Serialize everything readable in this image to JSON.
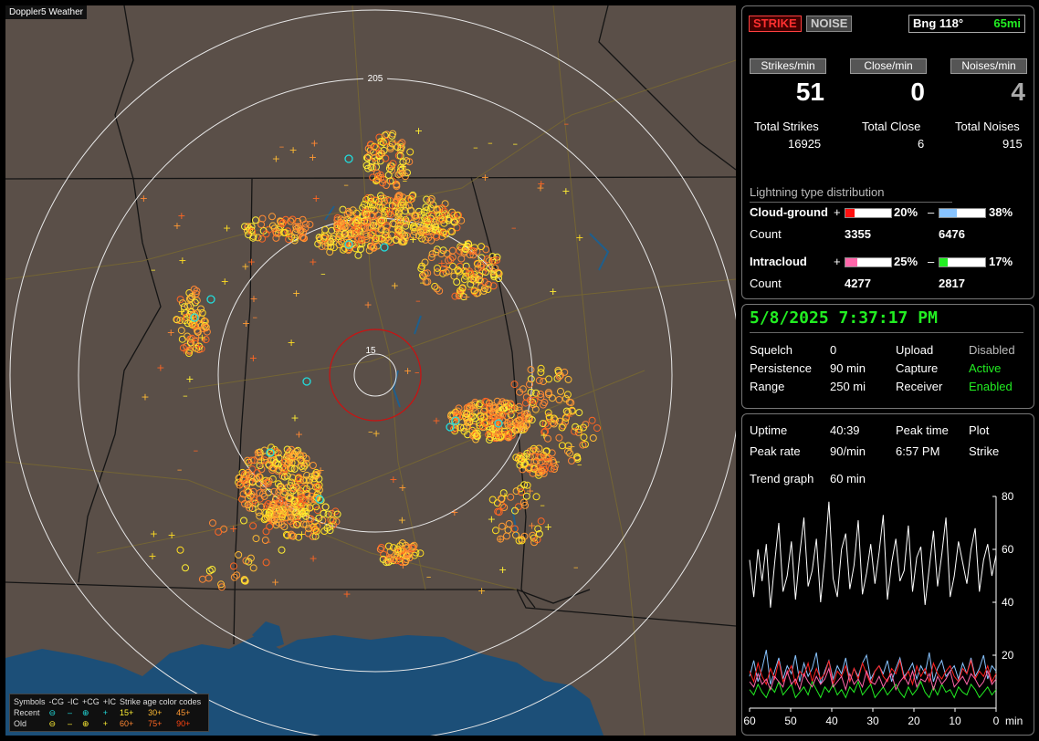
{
  "app": {
    "title": "Doppler5 Weather"
  },
  "map": {
    "range_labels": [
      "205",
      "15"
    ],
    "legend": {
      "header": [
        "Symbols",
        "-CG",
        "-IC",
        "+CG",
        "+IC"
      ],
      "age_header": "Strike age color codes",
      "rows": [
        {
          "label": "Recent",
          "ages": [
            "15+",
            "30+",
            "45+"
          ]
        },
        {
          "label": "Old",
          "ages": [
            "60+",
            "75+",
            "90+"
          ]
        }
      ]
    }
  },
  "header": {
    "strike_button": "STRIKE",
    "noise_button": "NOISE",
    "bearing_label": "Bng 118°",
    "bearing_distance": "65mi"
  },
  "rates": {
    "strikes_label": "Strikes/min",
    "strikes_value": "51",
    "close_label": "Close/min",
    "close_value": "0",
    "noises_label": "Noises/min",
    "noises_value": "4"
  },
  "totals": {
    "strikes_label": "Total Strikes",
    "strikes_value": "16925",
    "close_label": "Total Close",
    "close_value": "6",
    "noises_label": "Total Noises",
    "noises_value": "915"
  },
  "distribution": {
    "title": "Lightning type distribution",
    "cloud_ground": {
      "label": "Cloud-ground",
      "plus_pct": "20%",
      "minus_pct": "38%",
      "plus_fraction": 0.2,
      "minus_fraction": 0.38,
      "count_label": "Count",
      "plus_count": "3355",
      "minus_count": "6476",
      "plus_color": "#ff1010",
      "minus_color": "#88c4ff"
    },
    "intracloud": {
      "label": "Intracloud",
      "plus_pct": "25%",
      "minus_pct": "17%",
      "plus_fraction": 0.25,
      "minus_fraction": 0.17,
      "count_label": "Count",
      "plus_count": "4277",
      "minus_count": "2817",
      "plus_color": "#ff66aa",
      "minus_color": "#22ee22"
    },
    "plus_sign": "+",
    "minus_sign": "–"
  },
  "status": {
    "datetime": "5/8/2025 7:37:17 PM",
    "squelch_label": "Squelch",
    "squelch_value": "0",
    "persistence_label": "Persistence",
    "persistence_value": "90 min",
    "range_label": "Range",
    "range_value": "250 mi",
    "upload_label": "Upload",
    "upload_value": "Disabled",
    "capture_label": "Capture",
    "capture_value": "Active",
    "receiver_label": "Receiver",
    "receiver_value": "Enabled"
  },
  "stats": {
    "uptime_label": "Uptime",
    "uptime_value": "40:39",
    "peak_time_label": "Peak time",
    "peak_time_value": "6:57 PM",
    "plot_label": "Plot",
    "plot_value": "Strike",
    "peak_rate_label": "Peak rate",
    "peak_rate_value": "90/min",
    "trend_label": "Trend graph",
    "trend_value": "60 min"
  },
  "chart_data": {
    "type": "line",
    "xlabel": "min",
    "x_ticks": [
      "60",
      "50",
      "40",
      "30",
      "20",
      "10",
      "0"
    ],
    "y_ticks": [
      "80",
      "60",
      "40",
      "20"
    ],
    "xlim": [
      60,
      0
    ],
    "ylim": [
      0,
      80
    ],
    "series": [
      {
        "color": "#ffffff",
        "values": [
          56,
          42,
          60,
          48,
          62,
          38,
          55,
          70,
          44,
          50,
          63,
          41,
          58,
          72,
          46,
          52,
          64,
          40,
          57,
          78,
          49,
          42,
          60,
          66,
          45,
          54,
          71,
          43,
          51,
          62,
          47,
          59,
          73,
          41,
          55,
          64,
          48,
          52,
          69,
          44,
          57,
          61,
          39,
          53,
          67,
          46,
          58,
          72,
          42,
          50,
          63,
          55,
          47,
          60,
          68,
          44,
          56,
          62,
          50,
          58
        ]
      },
      {
        "color": "#88c4ff",
        "values": [
          12,
          18,
          10,
          15,
          22,
          9,
          14,
          19,
          11,
          16,
          13,
          20,
          10,
          17,
          12,
          15,
          21,
          9,
          14,
          18,
          11,
          16,
          13,
          19,
          10,
          15,
          12,
          17,
          20,
          11,
          14,
          16,
          13,
          18,
          10,
          15,
          19,
          12,
          14,
          17,
          11,
          16,
          13,
          21,
          10,
          15,
          18,
          12,
          14,
          16,
          11,
          17,
          13,
          19,
          12,
          15,
          20,
          11,
          16,
          14
        ]
      },
      {
        "color": "#ff2020",
        "values": [
          14,
          10,
          17,
          12,
          9,
          15,
          11,
          18,
          10,
          13,
          16,
          9,
          14,
          12,
          17,
          10,
          15,
          11,
          13,
          18,
          9,
          14,
          12,
          16,
          10,
          15,
          11,
          17,
          13,
          9,
          14,
          16,
          12,
          10,
          15,
          13,
          18,
          11,
          14,
          9,
          16,
          12,
          15,
          10,
          17,
          13,
          11,
          14,
          16,
          12,
          10,
          15,
          13,
          18,
          11,
          14,
          12,
          16,
          10,
          13
        ]
      },
      {
        "color": "#22ee22",
        "values": [
          7,
          5,
          9,
          6,
          4,
          8,
          6,
          10,
          5,
          7,
          9,
          4,
          6,
          8,
          5,
          10,
          7,
          4,
          8,
          6,
          9,
          5,
          7,
          4,
          8,
          6,
          10,
          5,
          7,
          9,
          4,
          6,
          8,
          5,
          7,
          9,
          6,
          4,
          8,
          5,
          7,
          10,
          6,
          4,
          8,
          5,
          9,
          6,
          7,
          4,
          8,
          6,
          5,
          9,
          7,
          4,
          6,
          8,
          5,
          7
        ]
      },
      {
        "color": "#ff66aa",
        "values": [
          10,
          8,
          13,
          9,
          11,
          7,
          12,
          10,
          8,
          14,
          9,
          11,
          7,
          13,
          10,
          8,
          12,
          9,
          11,
          15,
          8,
          10,
          12,
          7,
          13,
          9,
          11,
          8,
          14,
          10,
          9,
          12,
          8,
          11,
          13,
          7,
          10,
          12,
          9,
          14,
          8,
          11,
          10,
          13,
          7,
          12,
          9,
          11,
          14,
          8,
          10,
          12,
          9,
          13,
          11,
          8,
          10,
          14,
          9,
          11
        ]
      }
    ]
  }
}
